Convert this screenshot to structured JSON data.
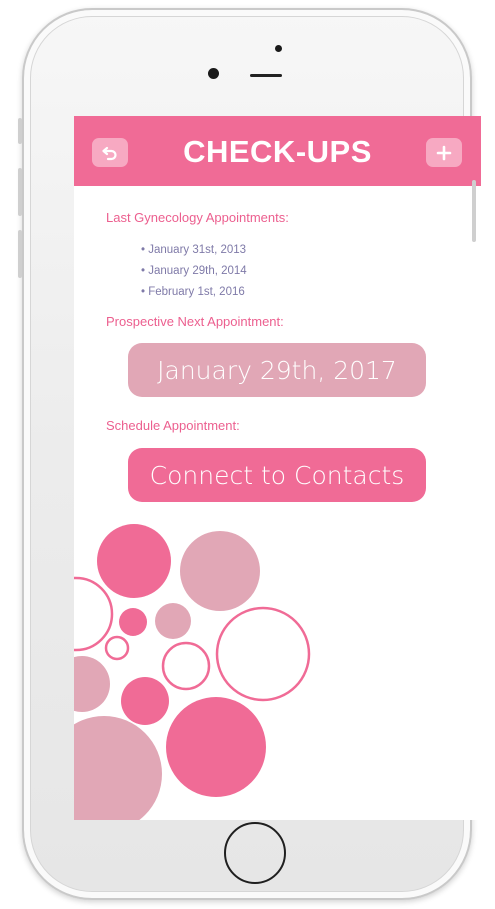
{
  "header": {
    "title": "CHECK-UPS",
    "back_icon": "undo-arrow-icon",
    "add_icon": "plus-icon"
  },
  "last_appointments": {
    "label": "Last Gynecology Appointments:",
    "items": [
      "January 31st, 2013",
      "January 29th, 2014",
      "February 1st, 2016"
    ]
  },
  "prospective": {
    "label": "Prospective Next Appointment:",
    "date": "January 29th, 2017"
  },
  "schedule": {
    "label": "Schedule Appointment:",
    "button_label": "Connect to Contacts"
  },
  "colors": {
    "accent_pink": "#f06b96",
    "muted_pink": "#e1a7b6",
    "list_text": "#7f7aa8"
  }
}
